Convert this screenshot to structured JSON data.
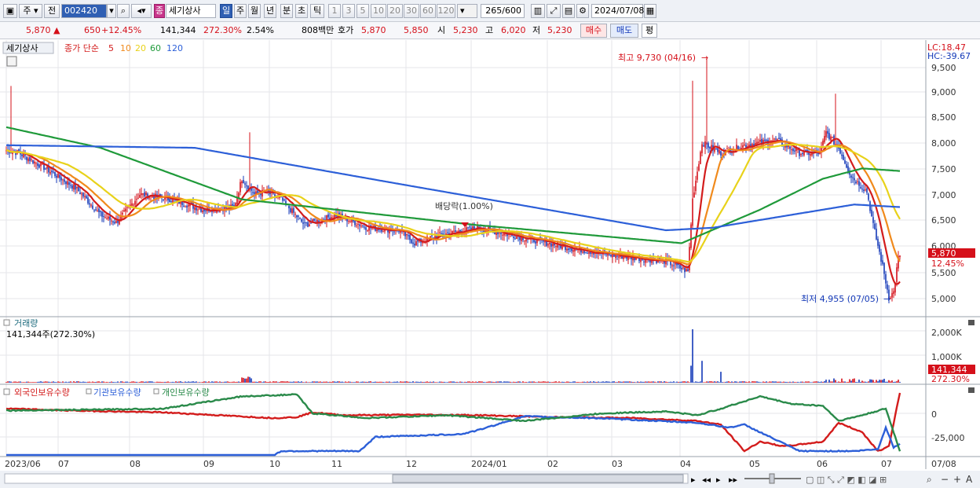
{
  "toolbar": {
    "period_type": "주",
    "prev_label": "전",
    "code": "002420",
    "stock_name": "세기상사",
    "stock_badge": "종",
    "intervals": [
      "일",
      "주",
      "월",
      "년",
      "분",
      "초",
      "틱"
    ],
    "active_interval": "일",
    "numbers": [
      "1",
      "3",
      "5",
      "10",
      "20",
      "30",
      "60",
      "120"
    ],
    "count": "265",
    "count_total": "/600",
    "date": "2024/07/08"
  },
  "info": {
    "price": "5,870",
    "change": "650",
    "change_pct": "+12.45%",
    "volume": "141,344",
    "vol_ratio": "272.30%",
    "turnover": "2.54%",
    "amount": "808백만",
    "quote_label": "호가",
    "ask": "5,870",
    "bid": "5,850",
    "open_label": "시",
    "open": "5,230",
    "high_label": "고",
    "high": "6,020",
    "low_label": "저",
    "low": "5,230",
    "buy_label": "매수",
    "sell_label": "매도",
    "flat_label": "평"
  },
  "legend": {
    "name_tag": "세기상사",
    "ma_title": "종가 단순",
    "ma_periods": [
      "5",
      "10",
      "20",
      "60",
      "120"
    ],
    "ma_colors": [
      "#d31c1c",
      "#f08a1c",
      "#e8d21a",
      "#1f9a3a",
      "#2c5fd8"
    ]
  },
  "price_panel": {
    "lc": "LC:18.47",
    "hc": "HC:-39.67",
    "high_note": "최고 9,730 (04/16)",
    "low_note": "최저 4,955 (07/05)",
    "ex_div": "배당락(1.00%)",
    "y_ticks": [
      "9,500",
      "9,000",
      "8,500",
      "8,000",
      "7,500",
      "7,000",
      "6,500",
      "6,000",
      "5,500",
      "5,000"
    ],
    "current_tag": "5,870",
    "current_pct": "12.45%"
  },
  "volume_panel": {
    "title": "거래량",
    "subtitle": "141,344주(272.30%)",
    "y_ticks": [
      "2,000K",
      "1,000K"
    ],
    "current_tag": "141,344",
    "current_pct": "272.30%"
  },
  "holding_panel": {
    "series": [
      "외국인보유수량",
      "기관보유수량",
      "개인보유수량"
    ],
    "colors": [
      "#d31c1c",
      "#2c5fd8",
      "#2a8a4a"
    ],
    "y_ticks": [
      "0",
      "-25,000"
    ]
  },
  "x_axis": {
    "labels": [
      "2023/06",
      "07",
      "08",
      "09",
      "10",
      "11",
      "12",
      "2024/01",
      "02",
      "03",
      "04",
      "05",
      "06",
      "07",
      "07/08"
    ]
  },
  "colors": {
    "up": "#d5101a",
    "down": "#1439b8",
    "accent": "#2f5fb3"
  }
}
